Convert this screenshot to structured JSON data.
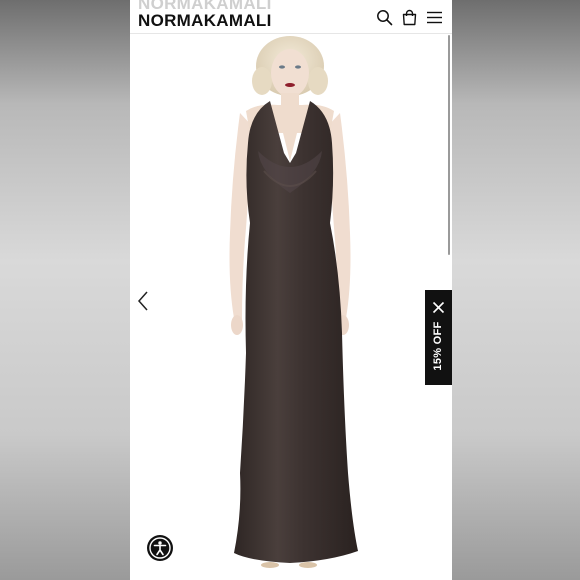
{
  "header": {
    "logo_text": "NORMAKAMALI",
    "icons": [
      "search-icon",
      "shopping-bag-icon",
      "hamburger-menu-icon"
    ]
  },
  "gallery": {
    "prev_icon": "chevron-left-icon",
    "product_image": "model-in-brown-halter-cowl-neck-gown"
  },
  "promo": {
    "label": "15% OFF",
    "close_icon": "close-icon"
  },
  "accessibility": {
    "icon": "accessibility-icon"
  },
  "colors": {
    "brand_black": "#111111",
    "gown_brown": "#3f3532",
    "background": "#ffffff"
  }
}
